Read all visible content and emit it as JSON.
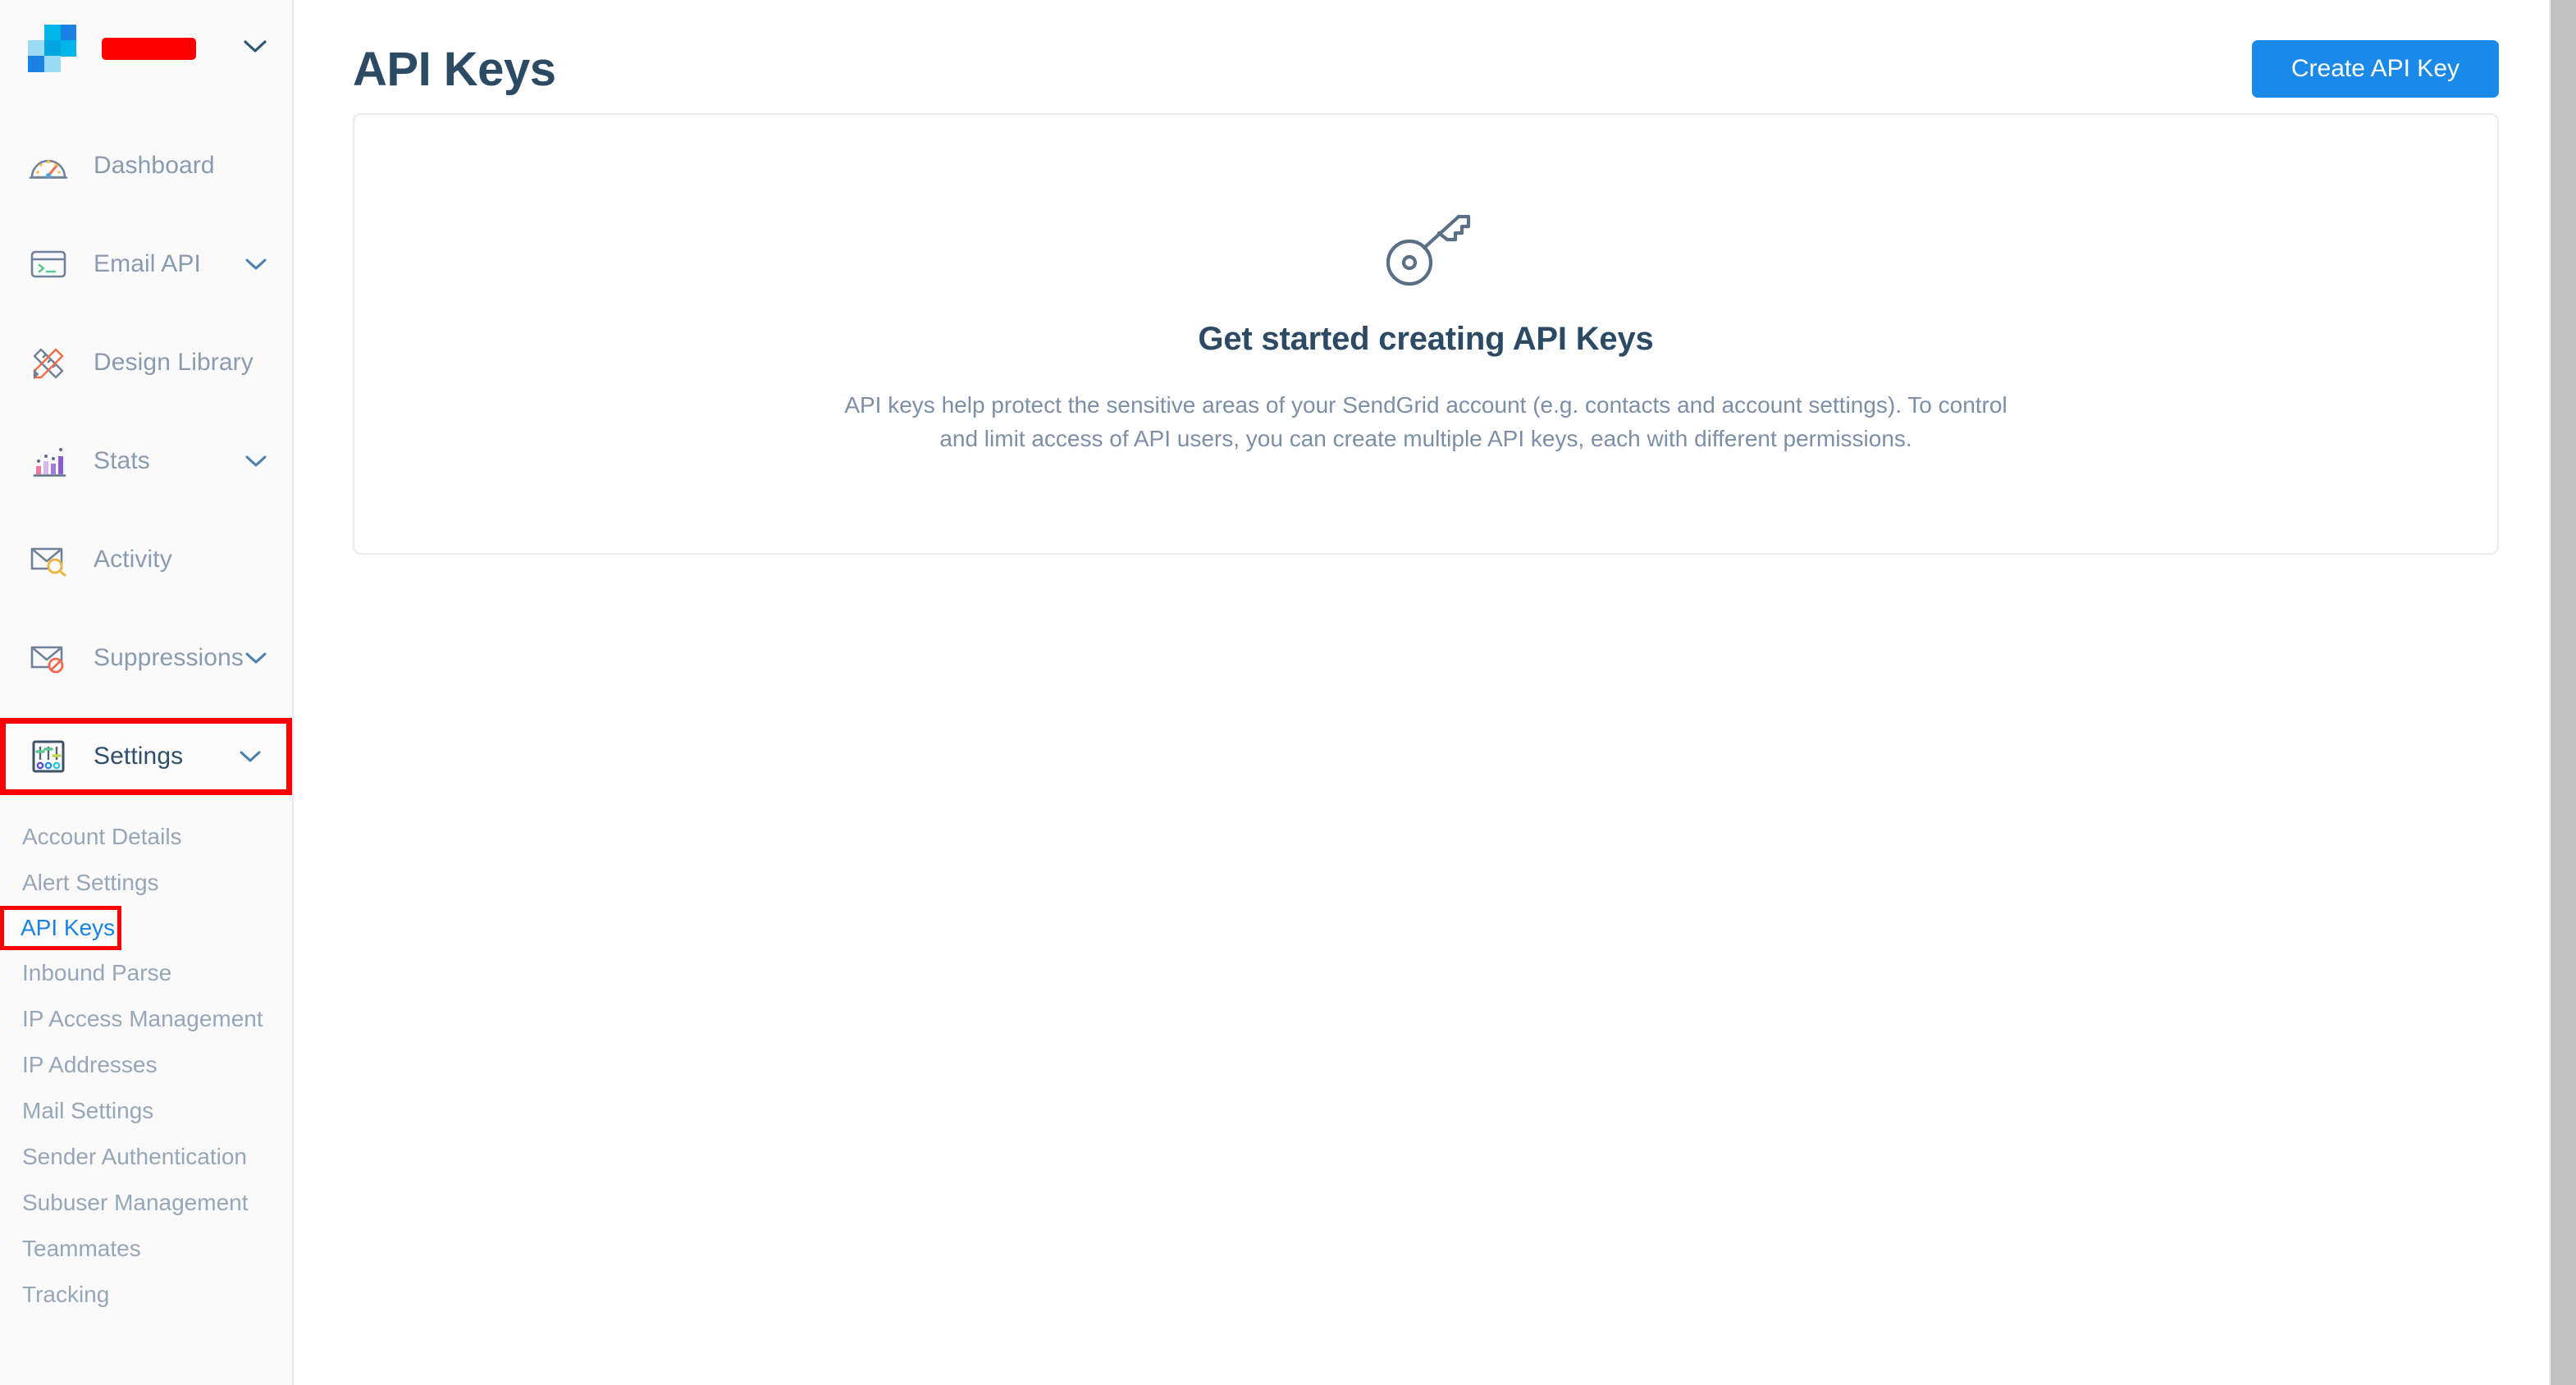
{
  "brand": {
    "logo_name": "sendgrid-logo",
    "account_name_redacted": "",
    "caret_icon": "chevron-down-icon",
    "colors": {
      "tile_dark_blue": "#1a82e2",
      "tile_mid_blue": "#00a5e0",
      "tile_cyan": "#00b5e8",
      "tile_light_blue": "#9bdcf5"
    }
  },
  "sidebar": {
    "items": [
      {
        "label": "Dashboard",
        "icon": "gauge-icon",
        "expandable": false
      },
      {
        "label": "Email API",
        "icon": "terminal-icon",
        "expandable": true
      },
      {
        "label": "Design Library",
        "icon": "ruler-pencil-icon",
        "expandable": false
      },
      {
        "label": "Stats",
        "icon": "bar-chart-icon",
        "expandable": true
      },
      {
        "label": "Activity",
        "icon": "envelope-search-icon",
        "expandable": false
      },
      {
        "label": "Suppressions",
        "icon": "envelope-blocked-icon",
        "expandable": true
      },
      {
        "label": "Settings",
        "icon": "sliders-icon",
        "expandable": true,
        "active": true,
        "highlighted": true
      }
    ],
    "submenu": [
      {
        "label": "Account Details"
      },
      {
        "label": "Alert Settings"
      },
      {
        "label": "API Keys",
        "current": true,
        "highlighted": true
      },
      {
        "label": "Inbound Parse"
      },
      {
        "label": "IP Access Management"
      },
      {
        "label": "IP Addresses"
      },
      {
        "label": "Mail Settings"
      },
      {
        "label": "Sender Authentication"
      },
      {
        "label": "Subuser Management"
      },
      {
        "label": "Teammates"
      },
      {
        "label": "Tracking"
      }
    ]
  },
  "main": {
    "page_title": "API Keys",
    "create_button_label": "Create API Key",
    "empty_state": {
      "icon": "key-icon",
      "heading": "Get started creating API Keys",
      "description": "API keys help protect the sensitive areas of your SendGrid account (e.g. contacts and account settings). To control and limit access of API users, you can create multiple API keys, each with different permissions."
    }
  },
  "colors": {
    "accent_blue": "#1a89e8",
    "title_navy": "#2c4a63",
    "muted_text": "#8a9bb0",
    "annotation_red": "#fe0000",
    "sidebar_bg": "#fafafa"
  }
}
